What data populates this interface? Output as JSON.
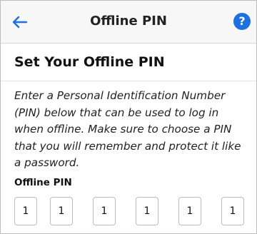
{
  "header": {
    "back_icon": "back-arrow-icon",
    "title": "Offline PIN",
    "help_label": "?",
    "accent_color": "#1e6fe0"
  },
  "content": {
    "heading": "Set Your Offline PIN",
    "description": "Enter a Personal Identification Number (PIN) below that can be used to log in when offline. Make sure to choose a PIN that you will remember and protect it like a password.",
    "pin_label": "Offline PIN",
    "pin_digits": [
      "1",
      "1",
      "1",
      "1",
      "1",
      "1"
    ]
  }
}
